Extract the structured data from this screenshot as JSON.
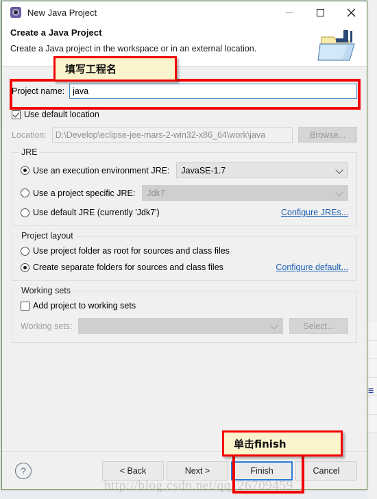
{
  "window": {
    "title": "New Java Project",
    "app_icon": "eclipse-gear-icon",
    "minimize_label": "—",
    "maximize_label": "□",
    "close_label": "✕"
  },
  "banner": {
    "title": "Create a Java Project",
    "description": "Create a Java project in the workspace or in an external location.",
    "icon": "java-project-folder-icon"
  },
  "project_name": {
    "label": "Project name:",
    "value": "java",
    "placeholder": ""
  },
  "location": {
    "use_default_label": "Use default location",
    "use_default_checked": true,
    "label": "Location:",
    "value": "D:\\Develop\\eclipse-jee-mars-2-win32-x86_64\\work\\java",
    "browse_label": "Browse..."
  },
  "jre": {
    "legend": "JRE",
    "option_execution_env": {
      "label": "Use an execution environment JRE:",
      "selected": true,
      "value": "JavaSE-1.7"
    },
    "option_project_specific": {
      "label": "Use a project specific JRE:",
      "selected": false,
      "value": "Jdk7"
    },
    "option_default": {
      "label": "Use default JRE (currently 'Jdk7')",
      "selected": false
    },
    "configure_link": "Configure JREs..."
  },
  "project_layout": {
    "legend": "Project layout",
    "option_project_folder": {
      "label": "Use project folder as root for sources and class files",
      "selected": false
    },
    "option_separate_folders": {
      "label": "Create separate folders for sources and class files",
      "selected": true
    },
    "configure_link": "Configure default..."
  },
  "working_sets": {
    "legend": "Working sets",
    "add_label": "Add project to working sets",
    "add_checked": false,
    "label": "Working sets:",
    "value": "",
    "select_label": "Select..."
  },
  "footer": {
    "help_label": "?",
    "back_label": "< Back",
    "next_label": "Next >",
    "finish_label": "Finish",
    "cancel_label": "Cancel"
  },
  "annotations": {
    "project_name_note": "填写工程名",
    "finish_note": "单击finish",
    "highlight_color": "#f20000",
    "note_background": "#fbf4cd"
  },
  "watermark": {
    "text": "http://blog.csdn.net/qq_26709459"
  },
  "background": {
    "edge_text": "☰"
  }
}
